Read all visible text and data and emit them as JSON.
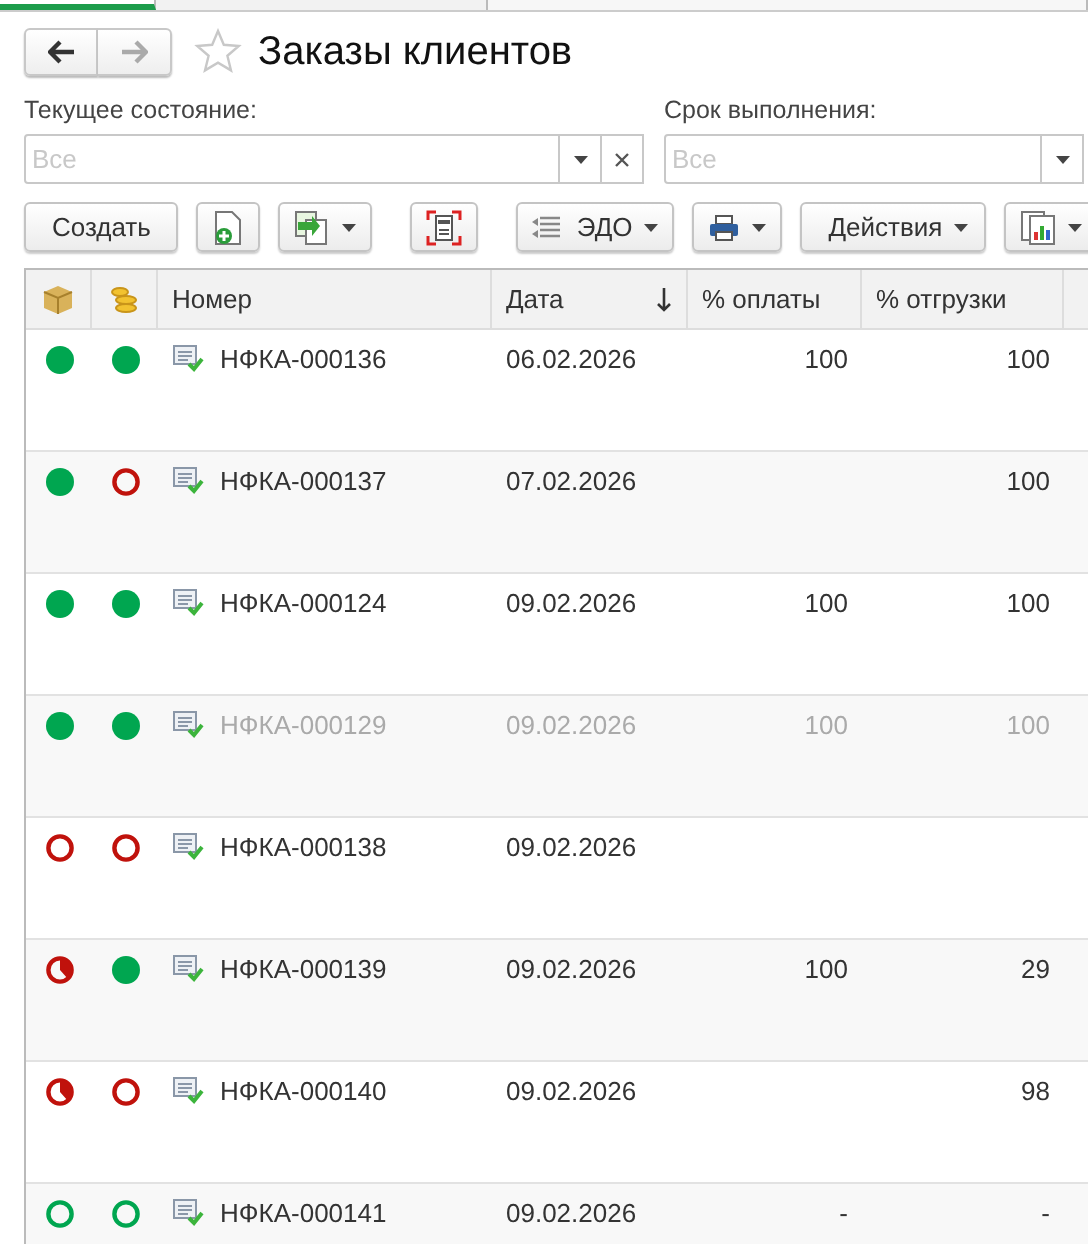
{
  "title": "Заказы клиентов",
  "filters": [
    {
      "label": "Текущее состояние:",
      "placeholder": "Все",
      "clearable": true
    },
    {
      "label": "Срок выполнения:",
      "placeholder": "Все",
      "clearable": false
    }
  ],
  "toolbar": {
    "create": "Создать",
    "edo": "ЭДО",
    "actions": "Действия"
  },
  "columns": [
    "Номер",
    "Дата",
    "% оплаты",
    "% отгрузки"
  ],
  "rows": [
    {
      "shipment": {
        "kind": "full",
        "color": "#00a650"
      },
      "payment": {
        "kind": "full",
        "color": "#00a650"
      },
      "number": "НФКА-000136",
      "date": "06.02.2026",
      "paid": "100",
      "shipped": "100",
      "inactive": false
    },
    {
      "shipment": {
        "kind": "full",
        "color": "#00a650"
      },
      "payment": {
        "kind": "empty",
        "color": "#c0120c"
      },
      "number": "НФКА-000137",
      "date": "07.02.2026",
      "shipped": "100",
      "inactive": false
    },
    {
      "shipment": {
        "kind": "full",
        "color": "#00a650"
      },
      "payment": {
        "kind": "full",
        "color": "#00a650"
      },
      "number": "НФКА-000124",
      "date": "09.02.2026",
      "paid": "100",
      "shipped": "100",
      "inactive": false
    },
    {
      "shipment": {
        "kind": "full",
        "color": "#00a650"
      },
      "payment": {
        "kind": "full",
        "color": "#00a650"
      },
      "number": "НФКА-000129",
      "date": "09.02.2026",
      "paid": "100",
      "shipped": "100",
      "inactive": true
    },
    {
      "shipment": {
        "kind": "empty",
        "color": "#c0120c"
      },
      "payment": {
        "kind": "empty",
        "color": "#c0120c"
      },
      "number": "НФКА-000138",
      "date": "09.02.2026",
      "inactive": false
    },
    {
      "shipment": {
        "kind": "partial",
        "color": "#c0120c"
      },
      "payment": {
        "kind": "full",
        "color": "#00a650"
      },
      "number": "НФКА-000139",
      "date": "09.02.2026",
      "paid": "100",
      "shipped": "29",
      "inactive": false
    },
    {
      "shipment": {
        "kind": "partial",
        "color": "#c0120c"
      },
      "payment": {
        "kind": "empty",
        "color": "#c0120c"
      },
      "number": "НФКА-000140",
      "date": "09.02.2026",
      "shipped": "98",
      "inactive": false
    },
    {
      "shipment": {
        "kind": "empty",
        "color": "#00a650"
      },
      "payment": {
        "kind": "empty",
        "color": "#00a650"
      },
      "number": "НФКА-000141",
      "date": "09.02.2026",
      "paid": "-",
      "shipped": "-",
      "inactive": false
    }
  ]
}
